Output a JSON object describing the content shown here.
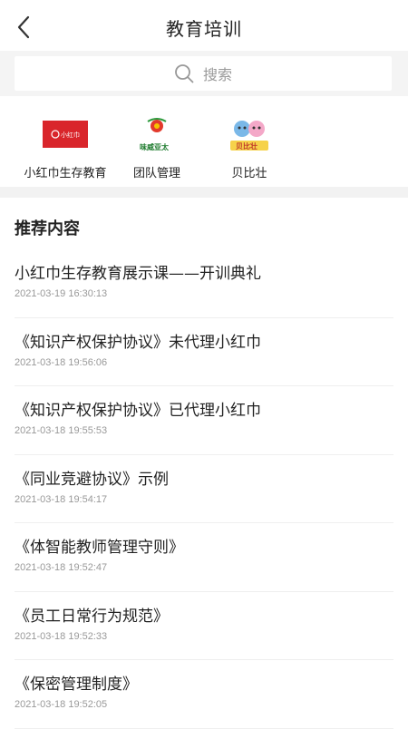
{
  "header": {
    "title": "教育培训"
  },
  "search": {
    "placeholder": "搜索"
  },
  "shortcuts": [
    {
      "label": "小红巾生存教育",
      "logo_text": "小红巾"
    },
    {
      "label": "团队管理",
      "logo_text": "味威亚太"
    },
    {
      "label": "贝比壮",
      "logo_text": "贝比壮"
    }
  ],
  "section": {
    "title": "推荐内容"
  },
  "articles": [
    {
      "title": "小红巾生存教育展示课——开训典礼",
      "time": "2021-03-19 16:30:13"
    },
    {
      "title": "《知识产权保护协议》未代理小红巾",
      "time": "2021-03-18 19:56:06"
    },
    {
      "title": "《知识产权保护协议》已代理小红巾",
      "time": "2021-03-18 19:55:53"
    },
    {
      "title": "《同业竞避协议》示例",
      "time": "2021-03-18 19:54:17"
    },
    {
      "title": "《体智能教师管理守则》",
      "time": "2021-03-18 19:52:47"
    },
    {
      "title": "《员工日常行为规范》",
      "time": "2021-03-18 19:52:33"
    },
    {
      "title": "《保密管理制度》",
      "time": "2021-03-18 19:52:05"
    }
  ],
  "colors": {
    "brand_red": "#d9252b",
    "divider": "#f2f2f2"
  }
}
